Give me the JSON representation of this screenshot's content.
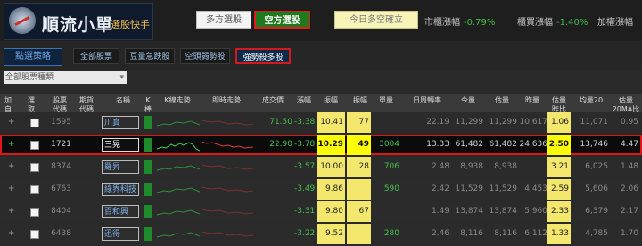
{
  "header": {
    "logo_title": "順流小單",
    "logo_sub": "選股快手",
    "btn_long": "多方選股",
    "btn_short": "空方選股",
    "btn_today": "今日多空確立",
    "stat1_label": "市櫃漲幅",
    "stat1_value": "-0.79%",
    "stat2_label": "櫃買漲幅",
    "stat2_value": "-1.40%",
    "stat3_label": "加權漲幅"
  },
  "toolbar": {
    "strategy": "點選策略",
    "tabs": [
      "全部股票",
      "豆量急跌股",
      "空頭弱勢股",
      "強勢殺多股"
    ],
    "active_tab_index": 3
  },
  "filter": {
    "value": "全部股票種類"
  },
  "columns": {
    "c0": "加自\n選",
    "c1": "選\n取",
    "c2": "股票\n代碼",
    "c3": "期貨\n代碼",
    "c4": "名稱",
    "c5": "K\n棒",
    "c6": "K線走勢",
    "c7": "即時走勢",
    "c8": "成交價",
    "c9": "漲幅",
    "c10": "振幅",
    "c11": "振幅",
    "c12": "單量",
    "c13": "日周轉率",
    "c14": "今量",
    "c15": "估量",
    "c16": "昨量",
    "c17": "估量\n昨比",
    "c18": "均量20",
    "c19": "估量\n20MA比"
  },
  "rows": [
    {
      "code": "1595",
      "name": "川寶",
      "price": "71.50",
      "chg": "-3.38",
      "amp1": "10.41",
      "amp2": "77",
      "vol": "",
      "turn": "22.19",
      "today": "11,299",
      "est": "11,299",
      "yest": "10,617",
      "ratio": "1.06",
      "ma20": "11,071",
      "ma_ratio": "0.95"
    },
    {
      "code": "1721",
      "name": "三晃",
      "price": "22.90",
      "chg": "-3.78",
      "amp1": "10.29",
      "amp2": "49",
      "vol": "3004",
      "turn": "13.33",
      "today": "61,482",
      "est": "61,482",
      "yest": "24,636",
      "ratio": "2.50",
      "ma20": "13,746",
      "ma_ratio": "4.47"
    },
    {
      "code": "8374",
      "name": "羅昇",
      "price": "",
      "chg": "-3.57",
      "amp1": "10.00",
      "amp2": "28",
      "vol": "706",
      "turn": "2.48",
      "today": "8,938",
      "est": "8,938",
      "yest": "",
      "ratio": "3.21",
      "ma20": "6,025",
      "ma_ratio": "1.48"
    },
    {
      "code": "6763",
      "name": "綠界科技",
      "price": "",
      "chg": "-3.49",
      "amp1": "9.86",
      "amp2": "",
      "vol": "590",
      "turn": "2.42",
      "today": "11,529",
      "est": "11,529",
      "yest": "4,453",
      "ratio": "2.59",
      "ma20": "5,606",
      "ma_ratio": "2.06"
    },
    {
      "code": "8404",
      "name": "百和興",
      "price": "",
      "chg": "-3.31",
      "amp1": "9.80",
      "amp2": "67",
      "vol": "",
      "turn": "1.49",
      "today": "13,874",
      "est": "13,874",
      "yest": "5,960",
      "ratio": "2.33",
      "ma20": "6,379",
      "ma_ratio": "2.17"
    },
    {
      "code": "6438",
      "name": "迅得",
      "price": "",
      "chg": "-3.22",
      "amp1": "9.52",
      "amp2": "",
      "vol": "280",
      "turn": "2.46",
      "today": "8,116",
      "est": "8,116",
      "yest": "6,112",
      "ratio": "1.33",
      "ma20": "4,785",
      "ma_ratio": "1.70"
    }
  ]
}
